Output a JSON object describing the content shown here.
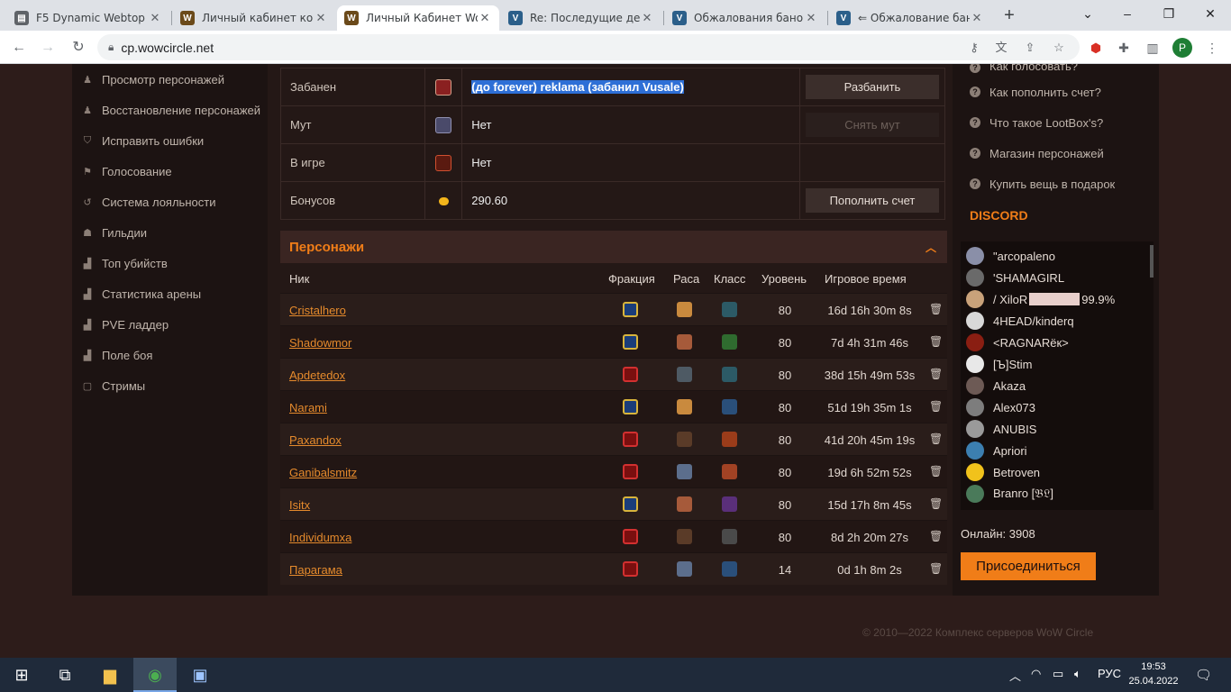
{
  "browser": {
    "tabs": [
      {
        "title": "F5 Dynamic Webtop",
        "favicon": "doc"
      },
      {
        "title": "Личный кабинет ком",
        "favicon": "W"
      },
      {
        "title": "Личный Кабинет WoW",
        "favicon": "W"
      },
      {
        "title": "Re: Последущие дейс",
        "favicon": "V"
      },
      {
        "title": "Обжалования банов",
        "favicon": "V"
      },
      {
        "title": "⇐ Обжалование бан",
        "favicon": "V"
      }
    ],
    "url": "cp.wowcircle.net",
    "profile_letter": "P"
  },
  "left_nav": [
    {
      "label": "Просмотр персонажей",
      "icon": "person-icon"
    },
    {
      "label": "Восстановление персонажей",
      "icon": "person-icon"
    },
    {
      "label": "Исправить ошибки",
      "icon": "shield-icon"
    },
    {
      "label": "Голосование",
      "icon": "flag-icon"
    },
    {
      "label": "Система лояльности",
      "icon": "history-icon"
    },
    {
      "label": "Гильдии",
      "icon": "group-icon"
    },
    {
      "label": "Топ убийств",
      "icon": "chart-icon"
    },
    {
      "label": "Статистика арены",
      "icon": "chart-icon"
    },
    {
      "label": "PVE ладдер",
      "icon": "chart-icon"
    },
    {
      "label": "Поле боя",
      "icon": "chart-icon"
    },
    {
      "label": "Стримы",
      "icon": "stream-icon"
    }
  ],
  "account": {
    "rows": [
      {
        "label": "Забанен",
        "value": "(до forever) reklama (забанил Vusale)",
        "action": "Разбанить",
        "action_disabled": false
      },
      {
        "label": "Мут",
        "value": "Нет",
        "action": "Снять мут",
        "action_disabled": true
      },
      {
        "label": "В игре",
        "value": "Нет",
        "action": "",
        "action_disabled": false
      },
      {
        "label": "Бонусов",
        "value": "290.60",
        "action": "Пополнить счет",
        "action_disabled": false
      }
    ]
  },
  "characters": {
    "title": "Персонажи",
    "columns": {
      "nick": "Ник",
      "faction": "Фракция",
      "race": "Раса",
      "class": "Класс",
      "level": "Уровень",
      "playtime": "Игровое время"
    },
    "rows": [
      {
        "name": "Cristalhero",
        "faction": "alliance",
        "race": "race1",
        "class": "cls1",
        "level": "80",
        "playtime": "16d 16h 30m 8s"
      },
      {
        "name": "Shadowmor",
        "faction": "alliance",
        "race": "race6",
        "class": "cls2",
        "level": "80",
        "playtime": "7d 4h 31m 46s"
      },
      {
        "name": "Apdetedox",
        "faction": "horde",
        "race": "race3",
        "class": "cls1",
        "level": "80",
        "playtime": "38d 15h 49m 53s"
      },
      {
        "name": "Narami",
        "faction": "alliance",
        "race": "race1",
        "class": "cls3",
        "level": "80",
        "playtime": "51d 19h 35m 1s"
      },
      {
        "name": "Paxandox",
        "faction": "horde",
        "race": "race4",
        "class": "cls4",
        "level": "80",
        "playtime": "41d 20h 45m 19s"
      },
      {
        "name": "Ganibalsmitz",
        "faction": "horde",
        "race": "race5",
        "class": "cls5",
        "level": "80",
        "playtime": "19d 6h 52m 52s"
      },
      {
        "name": "Isitx",
        "faction": "alliance",
        "race": "race6",
        "class": "cls6",
        "level": "80",
        "playtime": "15d 17h 8m 45s"
      },
      {
        "name": "Individumxa",
        "faction": "horde",
        "race": "race4",
        "class": "cls7",
        "level": "80",
        "playtime": "8d 2h 20m 27s"
      },
      {
        "name": "Парагама",
        "faction": "horde",
        "race": "race5",
        "class": "cls3",
        "level": "14",
        "playtime": "0d 1h 8m 2s"
      }
    ]
  },
  "right_links": [
    "Как голосовать?",
    "Как пополнить счет?",
    "Что такое LootBox's?",
    "Магазин персонажей",
    "Купить вещь в подарок"
  ],
  "discord": {
    "title": "DISCORD",
    "users": [
      {
        "name": "\"arcopaleno",
        "avatar": "#8a8fa8"
      },
      {
        "name": "'SHAMAGIRL",
        "avatar": "#6a6a6a"
      },
      {
        "name": "/ XiloR",
        "suffix": "99.9%",
        "redacted": true,
        "avatar": "#c9a27a"
      },
      {
        "name": "4HEAD/kinderq",
        "avatar": "#d8d8d8"
      },
      {
        "name": "<RAGNARёк>",
        "avatar": "#8a1e12"
      },
      {
        "name": "[Ъ]Stim",
        "avatar": "#e8e8e8"
      },
      {
        "name": "Akaza",
        "avatar": "#6d5a55"
      },
      {
        "name": "Alex073",
        "avatar": "#7d7d7d"
      },
      {
        "name": "ANUBIS",
        "avatar": "#9a9a9a"
      },
      {
        "name": "Apriori",
        "avatar": "#3c7fb0"
      },
      {
        "name": "Betroven",
        "avatar": "#f1c21b"
      },
      {
        "name": "Branro [𝔅𝔏]",
        "avatar": "#4a7a5a"
      }
    ],
    "online": "Онлайн: 3908",
    "join": "Присоединиться"
  },
  "footer": "© 2010—2022 Комплекс серверов WoW Circle",
  "taskbar": {
    "lang": "РУС",
    "time": "19:53",
    "date": "25.04.2022"
  }
}
